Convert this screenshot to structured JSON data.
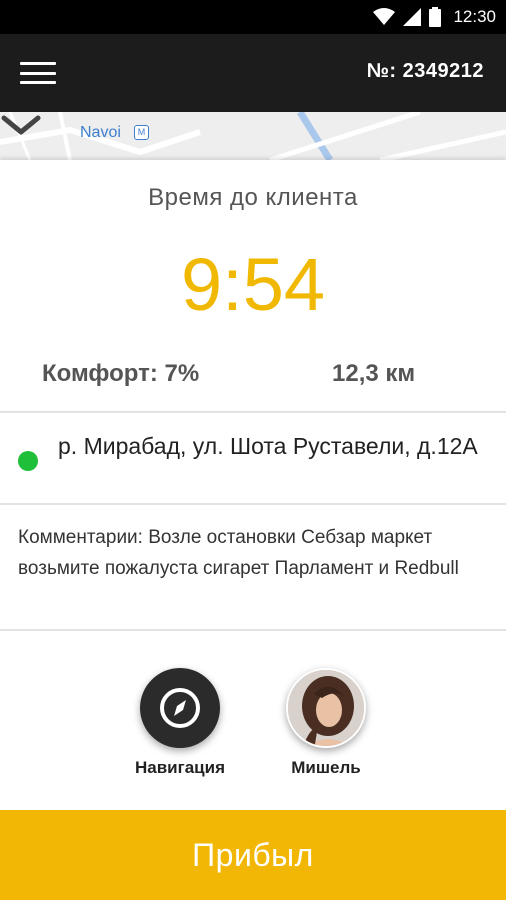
{
  "status_bar": {
    "time": "12:30",
    "icons": [
      "wifi-icon",
      "signal-icon",
      "battery-icon"
    ]
  },
  "header": {
    "menu_icon": "hamburger-menu-icon",
    "order_number": "№: 2349212"
  },
  "map": {
    "place_label": "Navoi",
    "metro_symbol": "M",
    "collapse_icon": "chevron-down-icon"
  },
  "trip": {
    "time_label": "Время до клиента",
    "timer": "9:54",
    "comfort": "Комфорт: 7%",
    "distance": "12,3 км"
  },
  "address": {
    "text": "р. Мирабад, ул. Шота Руставели, д.12А",
    "dot_color": "#1fbf3a"
  },
  "comment": {
    "text": "Комментарии: Возле остановки Себзар маркет возьмите пожалуста сигарет Парламент и Redbull"
  },
  "actions": {
    "navigation_label": "Навигация",
    "navigation_icon": "compass-icon",
    "client_label": "Мишель"
  },
  "primary_button": {
    "label": "Прибыл"
  },
  "colors": {
    "accent": "#f2b705",
    "timer": "#f0b800",
    "header_bg": "#1c1c1c"
  }
}
